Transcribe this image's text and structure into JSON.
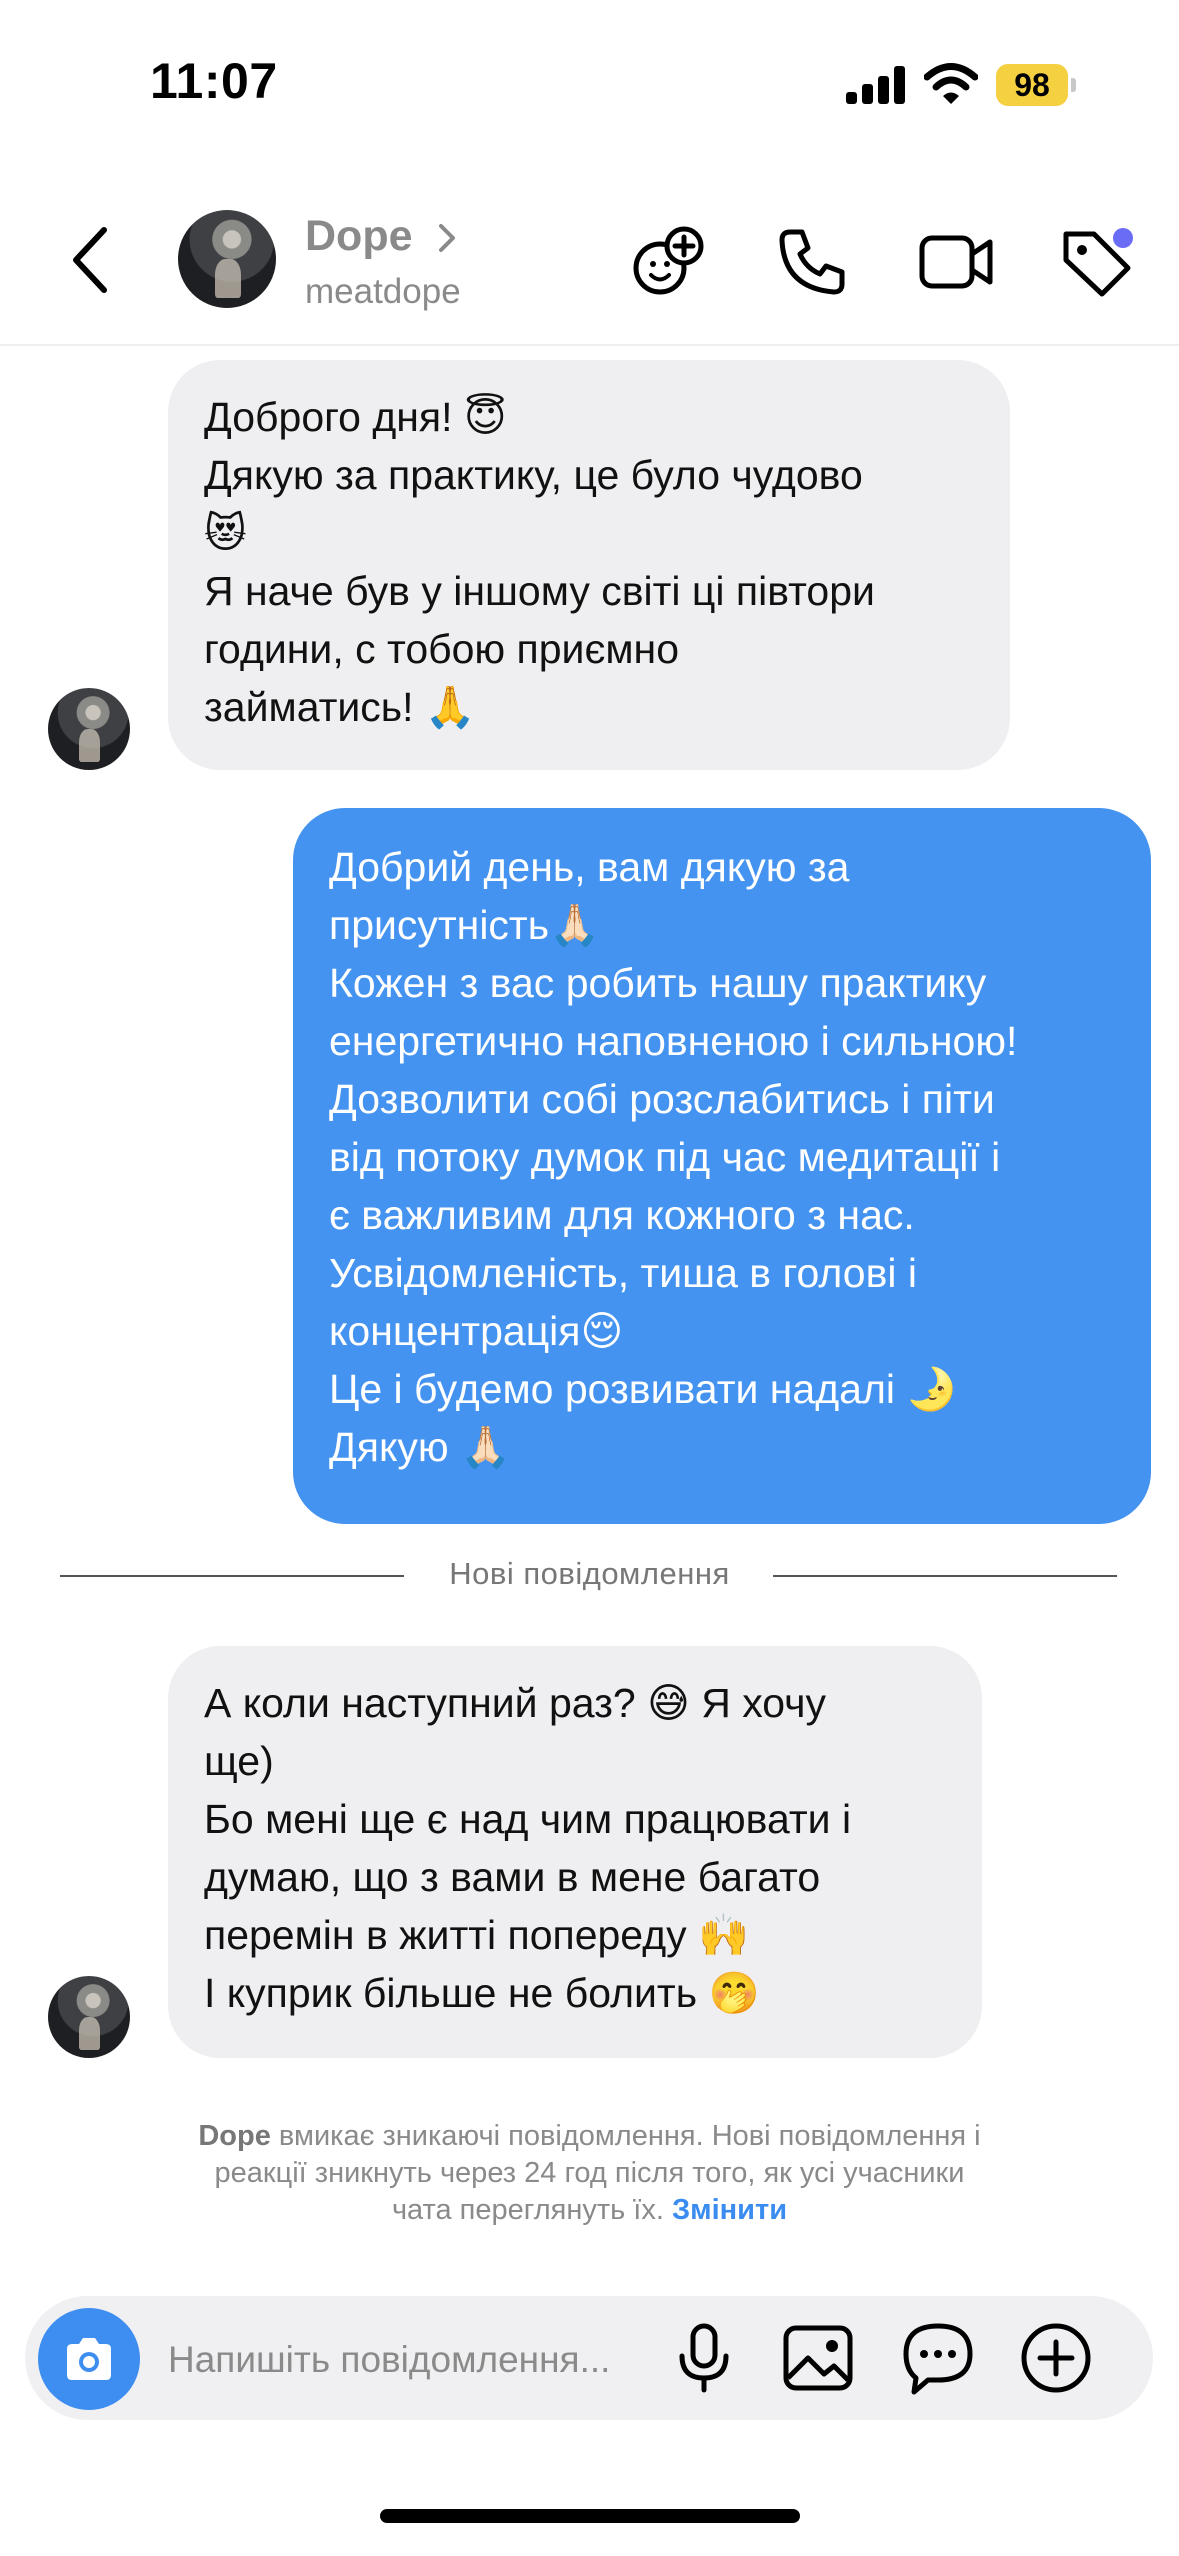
{
  "status_bar": {
    "time": "11:07",
    "battery": "98",
    "battery_color": "#f5d040"
  },
  "header": {
    "contact_name": "Dope",
    "contact_username": "meatdope",
    "icons": [
      "back-chevron-icon",
      "effects-icon",
      "phone-icon",
      "video-icon",
      "tag-icon"
    ],
    "tag_badge_color": "#6b6cf6"
  },
  "messages": {
    "m1": {
      "sender": "incoming",
      "lines": [
        "Доброго дня! 😇",
        "Дякую за практику, це було чудово",
        "😻",
        "Я наче був у іншому світі ці півтори",
        "години, с тобою приємно",
        "займатись! 🙏"
      ]
    },
    "m2": {
      "sender": "outgoing",
      "lines": [
        "Добрий день, вам дякую за",
        "присутність🙏🏻",
        "Кожен з вас робить нашу практику",
        "енергетично наповненою і сильною!",
        "Дозволити собі розслабитись і піти",
        "від потоку думок під час медитації і",
        "є важливим для кожного з нас.",
        "Усвідомленість, тиша в голові і",
        "концентрація😌",
        "Це і будемо розвивати надалі 🌛",
        "Дякую 🙏🏻"
      ]
    },
    "new_messages_label": "Нові повідомлення",
    "m3": {
      "sender": "incoming",
      "lines": [
        "А коли наступний раз? 😅 Я хочу",
        "ще)",
        "Бо мені ще є над чим працювати і",
        "думаю, що з вами в мене багато",
        "перемін в житті попереду 🙌",
        "І куприк більше не болить 🤭"
      ]
    }
  },
  "notice": {
    "name": "Dope",
    "lines": [
      "вмикає зникаючі повідомлення. Нові повідомлення і",
      "реакції зникнуть через 24 год після того, як усі учасники",
      "чата переглянуть їх."
    ],
    "link": "Змінити"
  },
  "composer": {
    "placeholder": "Напишіть повідомлення...",
    "icons": [
      "camera-icon",
      "microphone-icon",
      "gallery-icon",
      "sticker-icon",
      "plus-icon"
    ],
    "camera_color": "#3d8ef0"
  },
  "colors": {
    "outgoing_bubble": "#4493f0",
    "incoming_bubble": "#efeff1",
    "link": "#3a8cf0"
  }
}
